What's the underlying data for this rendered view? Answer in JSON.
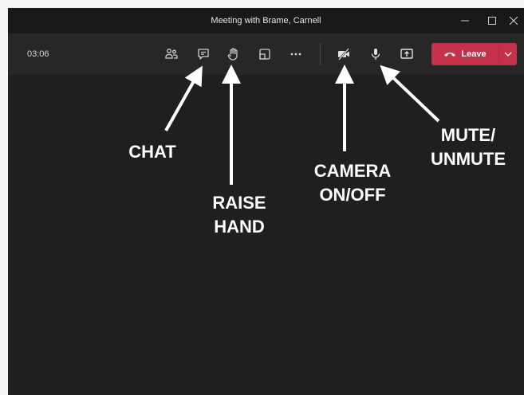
{
  "window": {
    "title": "Meeting with Brame, Carnell"
  },
  "window_controls": [
    "minimize-icon",
    "maximize-icon",
    "close-icon"
  ],
  "toolbar": {
    "timer": "03:06",
    "buttons": [
      "participants-icon",
      "chat-icon",
      "raise-hand-icon",
      "share-tray-icon",
      "more-options-icon",
      "camera-off-icon",
      "microphone-icon",
      "share-screen-icon"
    ],
    "leave_label": "Leave"
  },
  "annotations": {
    "chat": "CHAT",
    "raise_hand_1": "RAISE",
    "raise_hand_2": "HAND",
    "camera_1": "CAMERA",
    "camera_2": "ON/OFF",
    "mute_1": "MUTE/",
    "mute_2": "UNMUTE"
  },
  "colors": {
    "background": "#1f1f1f",
    "toolbar": "#272727",
    "leave": "#c4314b",
    "annotation": "#ffffff"
  }
}
